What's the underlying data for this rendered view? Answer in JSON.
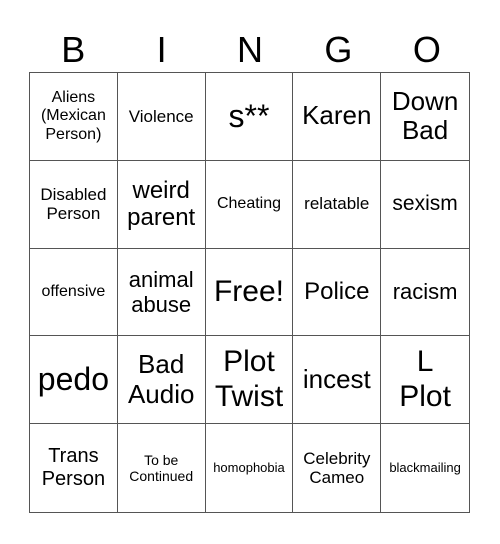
{
  "header": [
    "B",
    "I",
    "N",
    "G",
    "O"
  ],
  "cells": [
    "Aliens\n(Mexican\nPerson)",
    "Violence",
    "s**",
    "Karen",
    "Down\nBad",
    "Disabled\nPerson",
    "weird\nparent",
    "Cheating",
    "relatable",
    "sexism",
    "offensive",
    "animal\nabuse",
    "Free!",
    "Police",
    "racism",
    "pedo",
    "Bad\nAudio",
    "Plot\nTwist",
    "incest",
    "L\nPlot",
    "Trans\nPerson",
    "To be\nContinued",
    "homophobia",
    "Celebrity\nCameo",
    "blackmailing"
  ]
}
